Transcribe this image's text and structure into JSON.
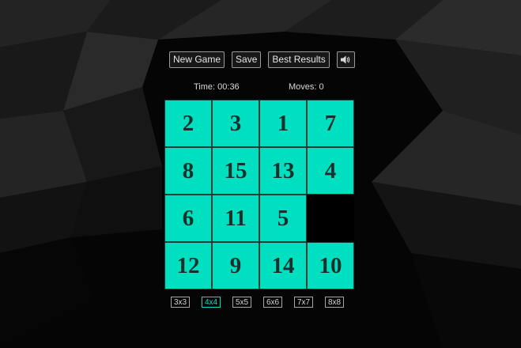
{
  "toolbar": {
    "new_game_label": "New Game",
    "save_label": "Save",
    "best_results_label": "Best Results",
    "sound_icon": "speaker-icon"
  },
  "stats": {
    "time_text": "Time: 00:36",
    "moves_text": "Moves: 0"
  },
  "board": {
    "size": 4,
    "tiles": [
      "2",
      "3",
      "1",
      "7",
      "8",
      "15",
      "13",
      "4",
      "6",
      "11",
      "5",
      "",
      "12",
      "9",
      "14",
      "10"
    ]
  },
  "sizes": {
    "options": [
      "3x3",
      "4x4",
      "5x5",
      "6x6",
      "7x7",
      "8x8"
    ],
    "selected": "4x4"
  },
  "colors": {
    "tile": "#00e0c0",
    "tile_text": "#18302c",
    "active_size": "#00e0c0"
  }
}
